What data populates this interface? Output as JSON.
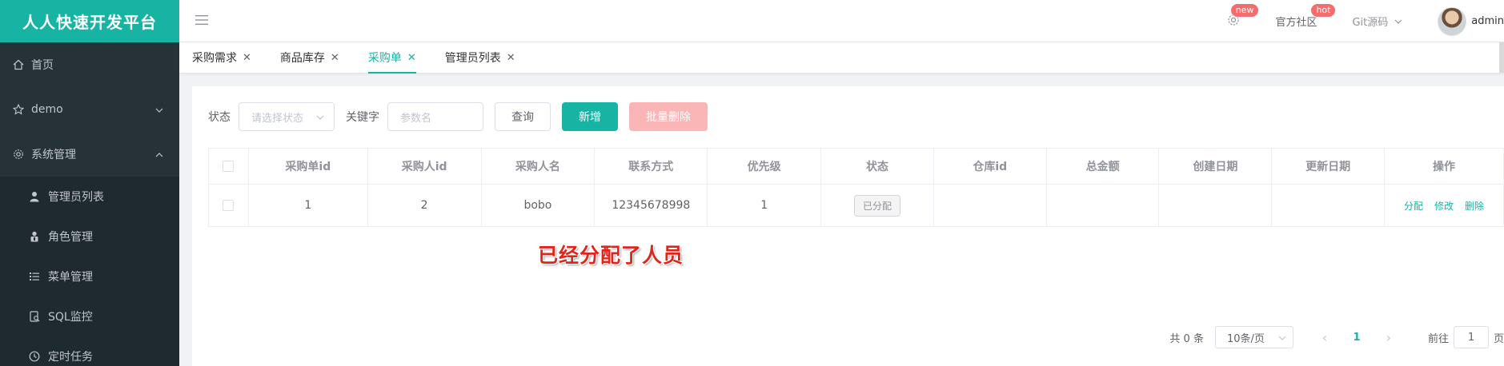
{
  "app": {
    "brand": "人人快速开发平台"
  },
  "sidebar": {
    "items": [
      {
        "label": "首页",
        "icon": "home-icon"
      },
      {
        "label": "demo",
        "icon": "star-icon"
      },
      {
        "label": "系统管理",
        "icon": "gear-icon"
      }
    ],
    "subitems": [
      {
        "label": "管理员列表",
        "icon": "user-icon"
      },
      {
        "label": "角色管理",
        "icon": "role-icon"
      },
      {
        "label": "菜单管理",
        "icon": "menu-list-icon"
      },
      {
        "label": "SQL监控",
        "icon": "sql-monitor-icon"
      },
      {
        "label": "定时任务",
        "icon": "clock-icon"
      }
    ]
  },
  "topbar": {
    "settings_badge": "new",
    "community": "官方社区",
    "community_badge": "hot",
    "git": "Git源码",
    "user": "admin"
  },
  "tabs": [
    {
      "label": "采购需求",
      "active": false
    },
    {
      "label": "商品库存",
      "active": false
    },
    {
      "label": "采购单",
      "active": true
    },
    {
      "label": "管理员列表",
      "active": false
    }
  ],
  "filter": {
    "status_label": "状态",
    "status_placeholder": "请选择状态",
    "keyword_label": "关键字",
    "keyword_placeholder": "参数名",
    "query": "查询",
    "add": "新增",
    "batch_delete": "批量删除"
  },
  "table": {
    "columns": [
      "采购单id",
      "采购人id",
      "采购人名",
      "联系方式",
      "优先级",
      "状态",
      "仓库id",
      "总金额",
      "创建日期",
      "更新日期",
      "操作"
    ],
    "rows": [
      {
        "c0": "1",
        "c1": "2",
        "c2": "bobo",
        "c3": "12345678998",
        "c4": "1",
        "status": "已分配",
        "c6": "",
        "c7": "",
        "c8": "",
        "c9": ""
      }
    ],
    "actions": [
      "分配",
      "修改",
      "删除"
    ]
  },
  "annotation": "已经分配了人员",
  "pager": {
    "total": "共 0 条",
    "size": "10条/页",
    "current": "1",
    "goto": "前往",
    "goto_value": "1",
    "page_suffix": "页"
  },
  "colors": {
    "brand": "#17b3a3",
    "sidebar": "#263238",
    "danger_light": "#fab6b6",
    "annotation": "#e0261a"
  }
}
